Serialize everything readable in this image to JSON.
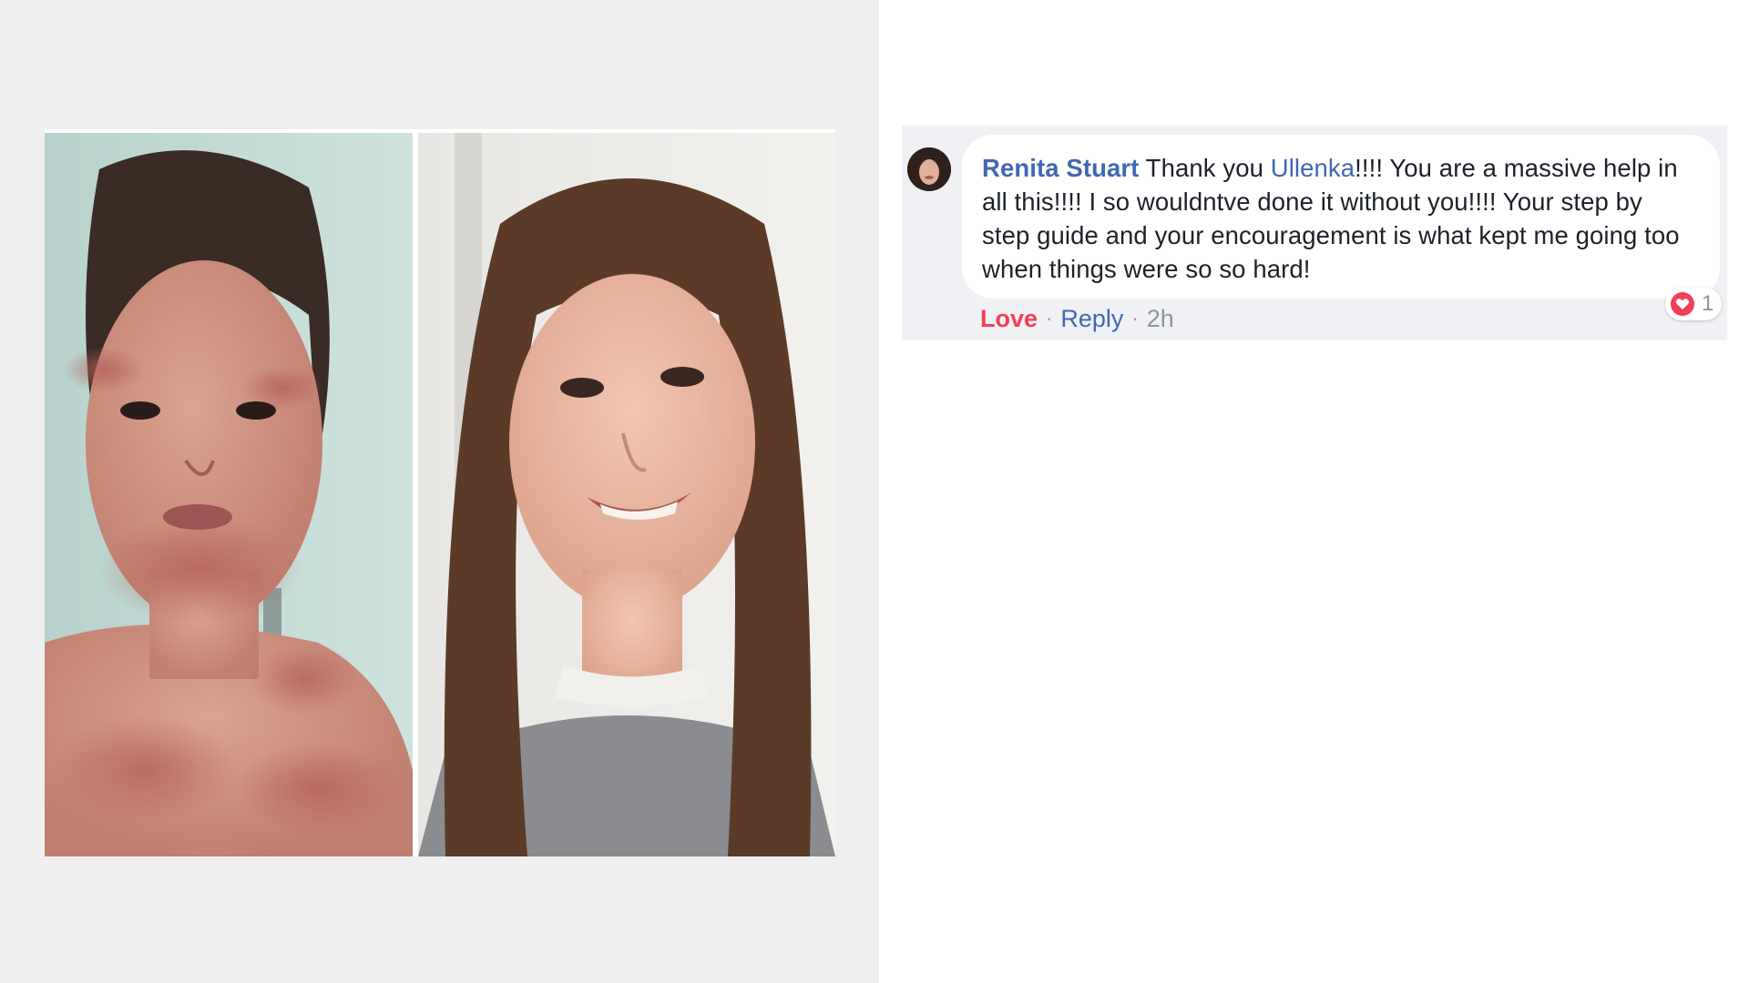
{
  "comment": {
    "author": "Renita Stuart",
    "text_before_mention": " Thank you ",
    "mention": "Ullenka",
    "text_after_mention": "!!!! You are a massive help in all this!!!! I so wouldntve done it without you!!!! Your step by step guide and your encouragement is what kept me going too when things were so so hard!",
    "actions": {
      "love": "Love",
      "reply": "Reply",
      "separator": "·",
      "time": "2h"
    },
    "reactions": {
      "icon": "heart-icon",
      "count": "1",
      "color": "#f33e58"
    }
  },
  "colors": {
    "link_blue": "#4267b2",
    "text": "#1d2129",
    "meta_grey": "#90949c",
    "panel_grey": "#efefef",
    "comment_bg": "#eff1f4"
  }
}
